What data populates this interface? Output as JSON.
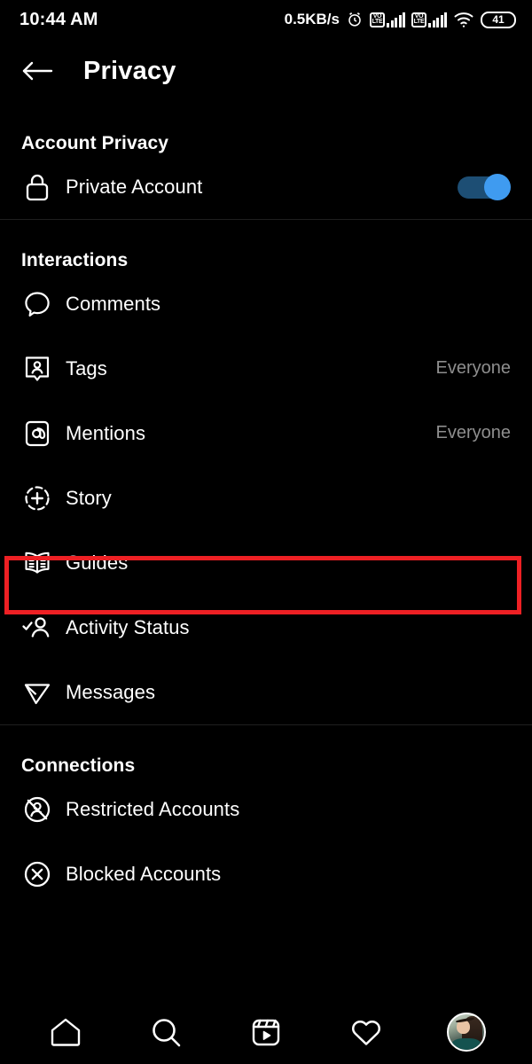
{
  "statusbar": {
    "time": "10:44 AM",
    "network_speed": "0.5KB/s",
    "alarm_icon": "alarm-clock-icon",
    "sim1_label": "VOLTE",
    "sim2_label": "VOLTE",
    "wifi_icon": "wifi-icon",
    "battery_level": "41"
  },
  "header": {
    "back_icon": "back-arrow-icon",
    "title": "Privacy"
  },
  "sections": [
    {
      "title": "Account Privacy",
      "rows": [
        {
          "icon": "lock-icon",
          "label": "Private Account",
          "value": "",
          "control": "toggle",
          "toggle_on": true
        }
      ]
    },
    {
      "title": "Interactions",
      "rows": [
        {
          "icon": "comment-icon",
          "label": "Comments",
          "value": "",
          "control": "none"
        },
        {
          "icon": "tag-icon",
          "label": "Tags",
          "value": "Everyone",
          "control": "none"
        },
        {
          "icon": "mention-icon",
          "label": "Mentions",
          "value": "Everyone",
          "control": "none"
        },
        {
          "icon": "story-icon",
          "label": "Story",
          "value": "",
          "control": "none",
          "highlighted": true
        },
        {
          "icon": "guides-icon",
          "label": "Guides",
          "value": "",
          "control": "none"
        },
        {
          "icon": "activity-status-icon",
          "label": "Activity Status",
          "value": "",
          "control": "none"
        },
        {
          "icon": "messages-icon",
          "label": "Messages",
          "value": "",
          "control": "none"
        }
      ]
    },
    {
      "title": "Connections",
      "rows": [
        {
          "icon": "restricted-icon",
          "label": "Restricted Accounts",
          "value": "",
          "control": "none"
        },
        {
          "icon": "blocked-icon",
          "label": "Blocked Accounts",
          "value": "",
          "control": "none"
        }
      ]
    }
  ],
  "bottom_nav": [
    {
      "icon": "home-icon",
      "label": "Home"
    },
    {
      "icon": "search-icon",
      "label": "Search"
    },
    {
      "icon": "reels-icon",
      "label": "Reels"
    },
    {
      "icon": "heart-icon",
      "label": "Activity"
    },
    {
      "icon": "profile-avatar",
      "label": "Profile"
    }
  ],
  "colors": {
    "background": "#000000",
    "text": "#ffffff",
    "muted_text": "#8e8e8e",
    "toggle_track": "#1d4e74",
    "toggle_knob": "#3f9bf0",
    "highlight": "#ee2024",
    "divider": "#1f1f1f"
  }
}
